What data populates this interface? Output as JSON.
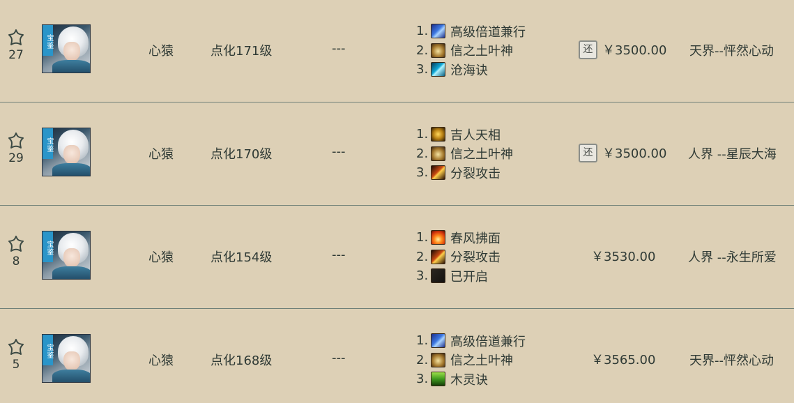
{
  "listings": [
    {
      "fav_count": "27",
      "avatar_tag": "宝鉴",
      "name": "心猿",
      "level": "点化171级",
      "dash": "---",
      "skills": [
        {
          "num": "1.",
          "name": "高级倍道兼行",
          "icon": "blue-swirl-icon"
        },
        {
          "num": "2.",
          "name": "信之土叶神",
          "icon": "gold-leaf-icon"
        },
        {
          "num": "3.",
          "name": "沧海诀",
          "icon": "cyan-wave-icon"
        }
      ],
      "return_badge": "还",
      "price": "￥3500.00",
      "server": "天界--怦然心动"
    },
    {
      "fav_count": "29",
      "avatar_tag": "宝鉴",
      "name": "心猿",
      "level": "点化170级",
      "dash": "---",
      "skills": [
        {
          "num": "1.",
          "name": "吉人天相",
          "icon": "gold-lucky-icon"
        },
        {
          "num": "2.",
          "name": "信之土叶神",
          "icon": "gold-leaf-icon"
        },
        {
          "num": "3.",
          "name": "分裂攻击",
          "icon": "fire-split-icon"
        }
      ],
      "return_badge": "还",
      "price": "￥3500.00",
      "server": "人界 --星辰大海"
    },
    {
      "fav_count": "8",
      "avatar_tag": "宝鉴",
      "name": "心猿",
      "level": "点化154级",
      "dash": "---",
      "skills": [
        {
          "num": "1.",
          "name": "春风拂面",
          "icon": "flame-spring-icon"
        },
        {
          "num": "2.",
          "name": "分裂攻击",
          "icon": "fire-split-icon"
        },
        {
          "num": "3.",
          "name": "已开启",
          "icon": "dark-slot-icon"
        }
      ],
      "return_badge": "",
      "price": "￥3530.00",
      "server": "人界 --永生所爱"
    },
    {
      "fav_count": "5",
      "avatar_tag": "宝鉴",
      "name": "心猿",
      "level": "点化168级",
      "dash": "---",
      "skills": [
        {
          "num": "1.",
          "name": "高级倍道兼行",
          "icon": "blue-swirl-icon"
        },
        {
          "num": "2.",
          "name": "信之土叶神",
          "icon": "gold-leaf-icon"
        },
        {
          "num": "3.",
          "name": "木灵诀",
          "icon": "green-wood-icon"
        }
      ],
      "return_badge": "",
      "price": "￥3565.00",
      "server": "天界--怦然心动"
    }
  ]
}
